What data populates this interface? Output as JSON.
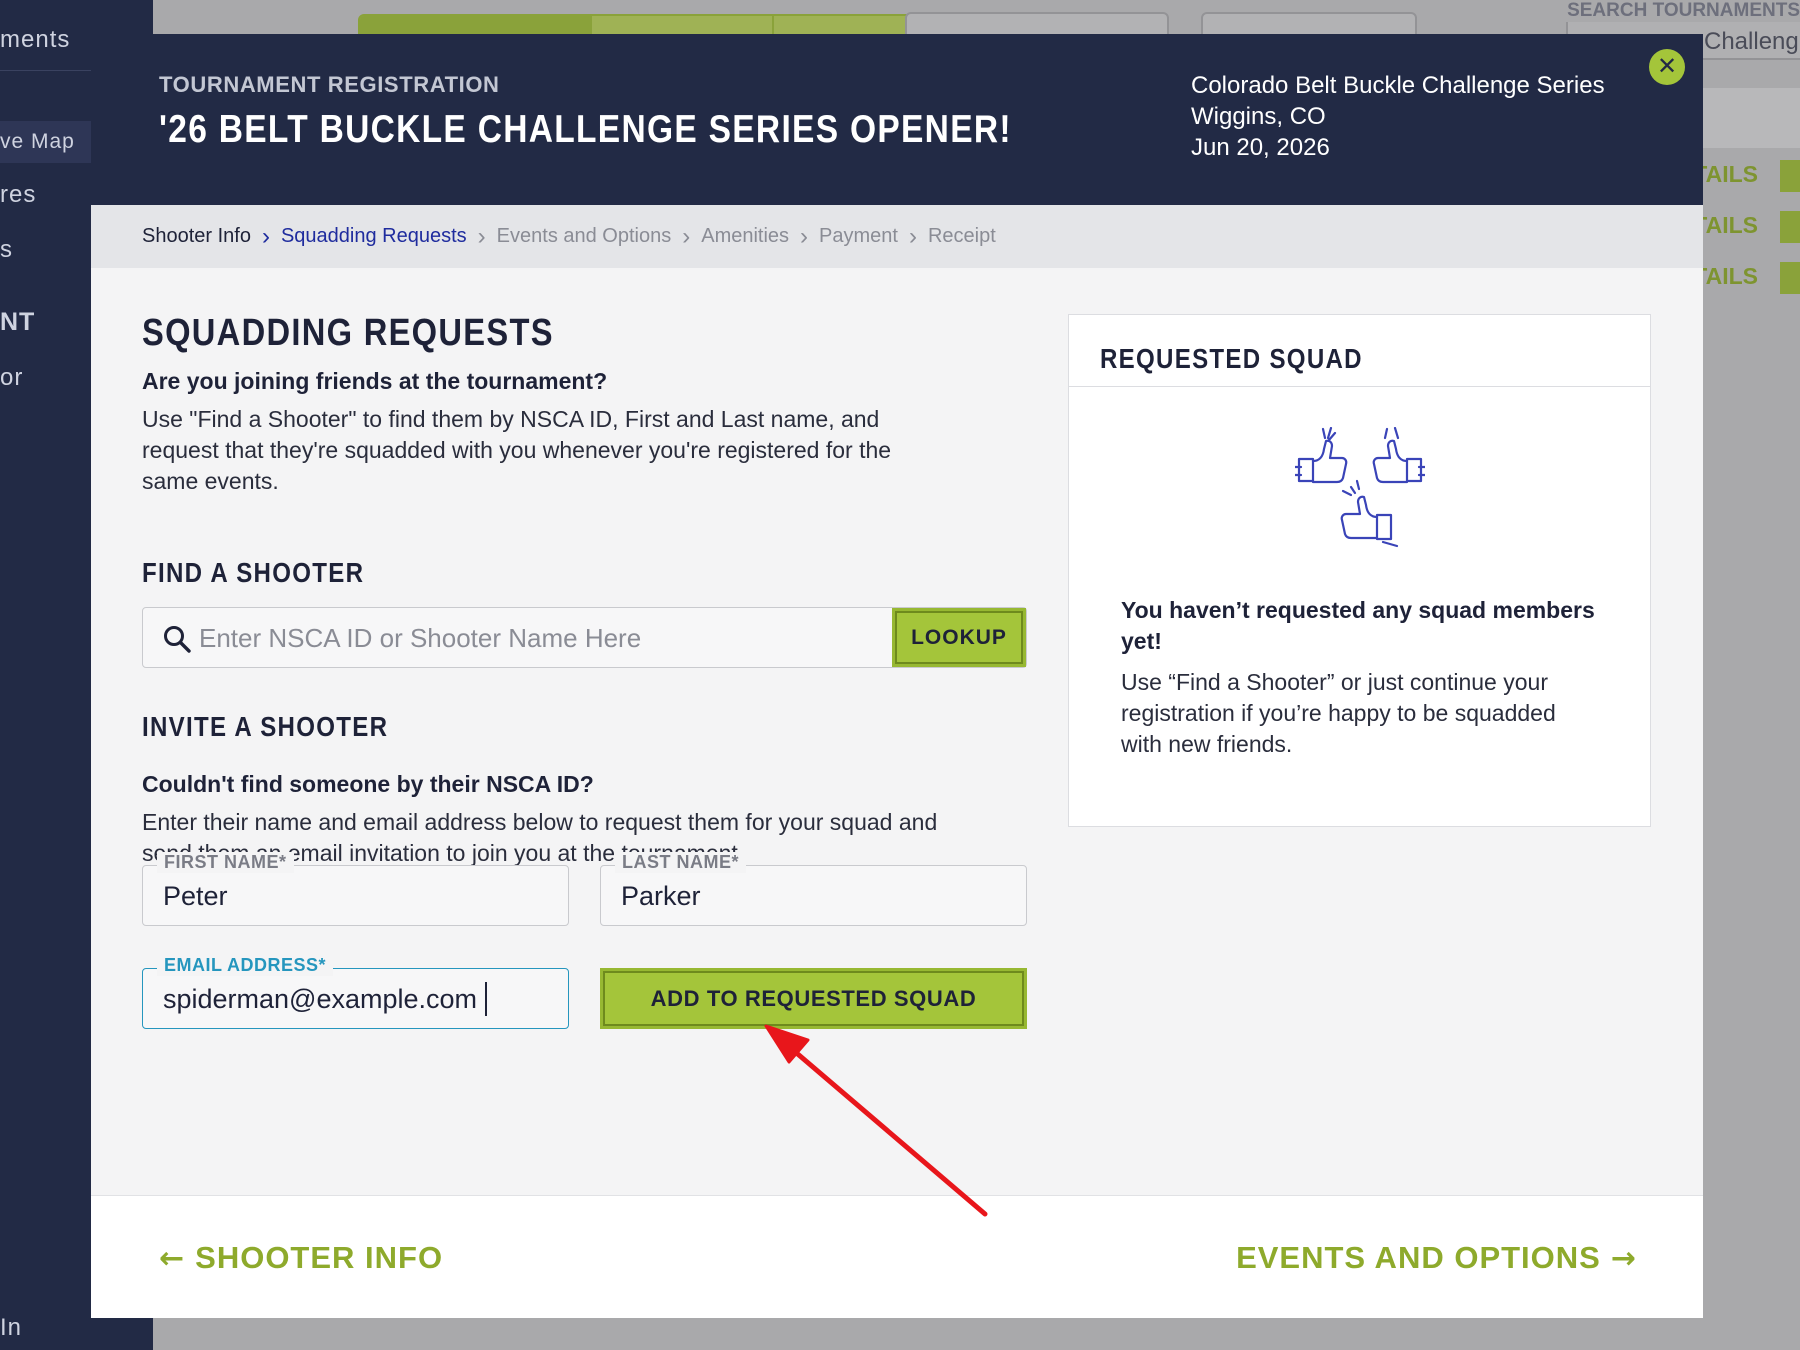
{
  "background": {
    "sidebar": {
      "items": [
        "ments",
        "ve Map",
        "res",
        "s",
        "NT",
        "or",
        "In"
      ]
    },
    "search_label": "SEARCH TOURNAMENTS",
    "search_value": "Challeng",
    "details_label": "TAILS"
  },
  "modal": {
    "kicker": "TOURNAMENT REGISTRATION",
    "title": "'26 BELT BUCKLE CHALLENGE SERIES OPENER!",
    "info": {
      "series": "Colorado Belt Buckle Challenge Series",
      "location": "Wiggins, CO",
      "date": "Jun 20, 2026"
    },
    "close_glyph": "✕",
    "breadcrumbs": [
      {
        "label": "Shooter Info",
        "state": "done"
      },
      {
        "label": "Squadding Requests",
        "state": "current"
      },
      {
        "label": "Events and Options",
        "state": "upcoming"
      },
      {
        "label": "Amenities",
        "state": "upcoming"
      },
      {
        "label": "Payment",
        "state": "upcoming"
      },
      {
        "label": "Receipt",
        "state": "upcoming"
      }
    ],
    "squadding": {
      "heading": "SQUADDING REQUESTS",
      "question": "Are you joining friends at the tournament?",
      "description": "Use \"Find a Shooter\" to find them by NSCA ID, First and Last name, and request that they're squadded with you whenever you're registered for the same events."
    },
    "find": {
      "heading": "FIND A SHOOTER",
      "placeholder": "Enter NSCA ID or Shooter Name Here",
      "value": "",
      "button": "LOOKUP"
    },
    "invite": {
      "heading": "INVITE A SHOOTER",
      "question": "Couldn't find someone by their NSCA ID?",
      "description": "Enter their name and email address below to request them for your squad and send them an email invitation to join you at the tournament.",
      "first_name": {
        "label": "FIRST NAME*",
        "value": "Peter"
      },
      "last_name": {
        "label": "LAST NAME*",
        "value": "Parker"
      },
      "email": {
        "label": "EMAIL ADDRESS*",
        "value": "spiderman@example.com"
      },
      "button": "ADD TO REQUESTED SQUAD"
    },
    "requested_squad": {
      "heading": "REQUESTED SQUAD",
      "empty_title": "You haven’t requested any squad members yet!",
      "empty_text": "Use “Find a Shooter” or just continue your registration if you’re happy to be squadded with new friends."
    },
    "footer": {
      "back_label": "SHOOTER INFO",
      "next_label": "EVENTS AND OPTIONS"
    },
    "colors": {
      "navy": "#222a45",
      "accent_green": "#a4c53a",
      "link_blue": "#1f2c9e",
      "focus_blue": "#2596be",
      "annotation_red": "#e8161b"
    }
  }
}
